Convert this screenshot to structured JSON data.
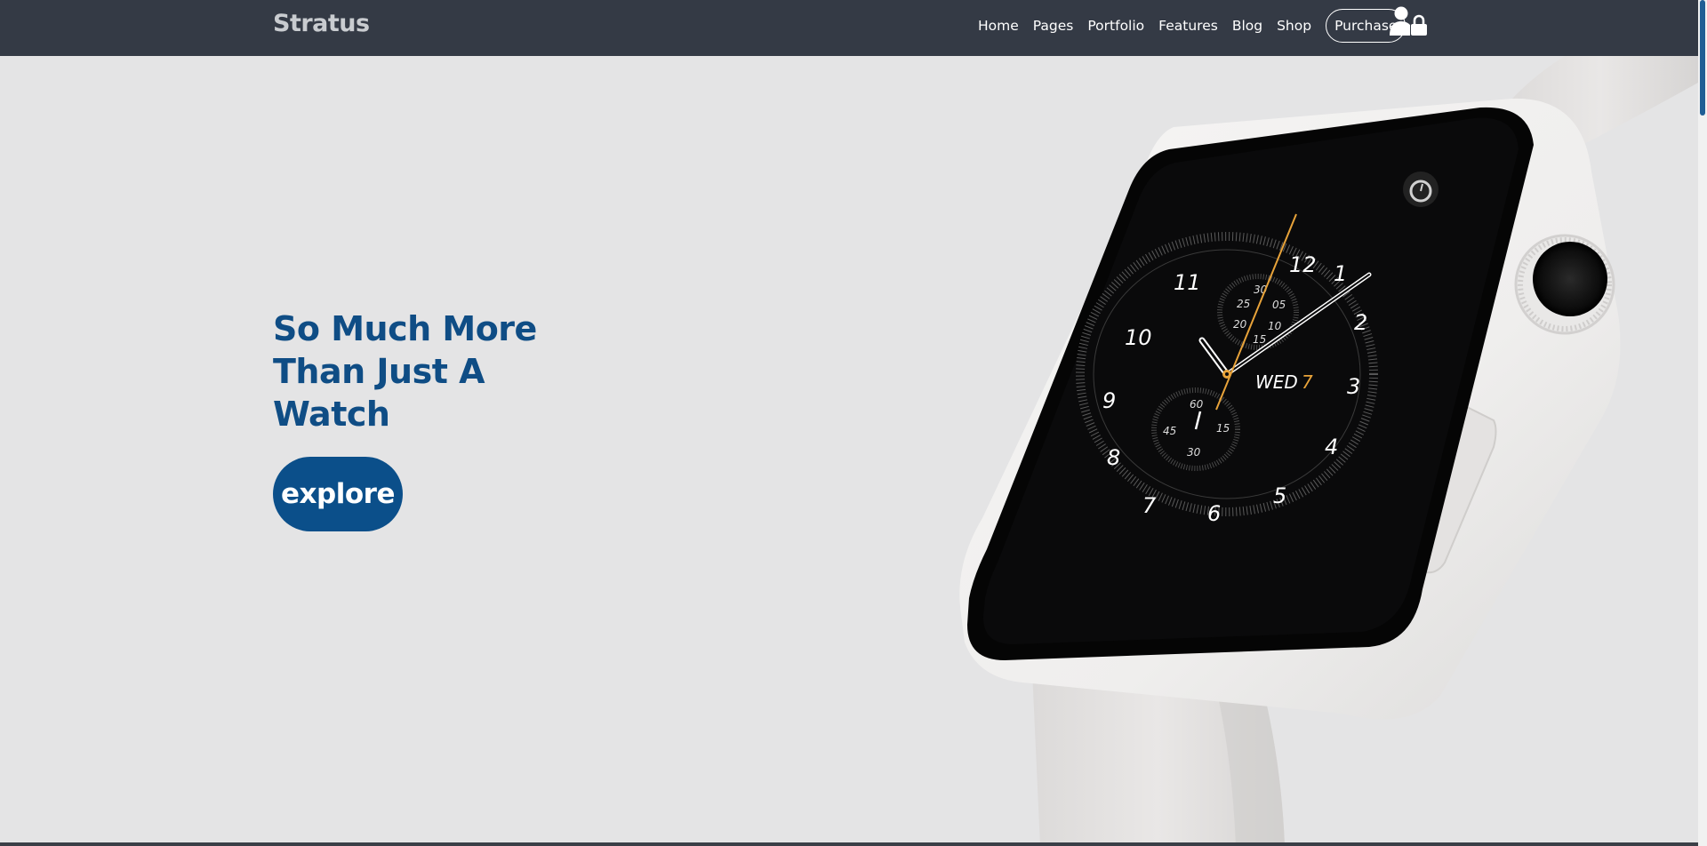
{
  "header": {
    "brand": "Stratus",
    "nav": [
      "Home",
      "Pages",
      "Portfolio",
      "Features",
      "Blog",
      "Shop"
    ],
    "purchase_label": "Purchase",
    "account_icon": "user-lock-icon"
  },
  "hero": {
    "title": "So Much More Than Just A Watch",
    "cta_label": "explore",
    "image": "smartwatch-image"
  },
  "watch_face": {
    "hours": [
      "12",
      "1",
      "2",
      "3",
      "4",
      "5",
      "6",
      "7",
      "8",
      "9",
      "10",
      "11"
    ],
    "day": "WED",
    "date": "7",
    "upper_subdial": [
      "30",
      "05",
      "10",
      "15",
      "20",
      "25"
    ],
    "lower_subdial": [
      "60",
      "15",
      "30",
      "45"
    ]
  },
  "colors": {
    "navbar": "#343a45",
    "accent": "#0b4f8a",
    "title": "#0f4d85",
    "background": "#e4e4e5",
    "date_accent": "#e8a33a"
  }
}
